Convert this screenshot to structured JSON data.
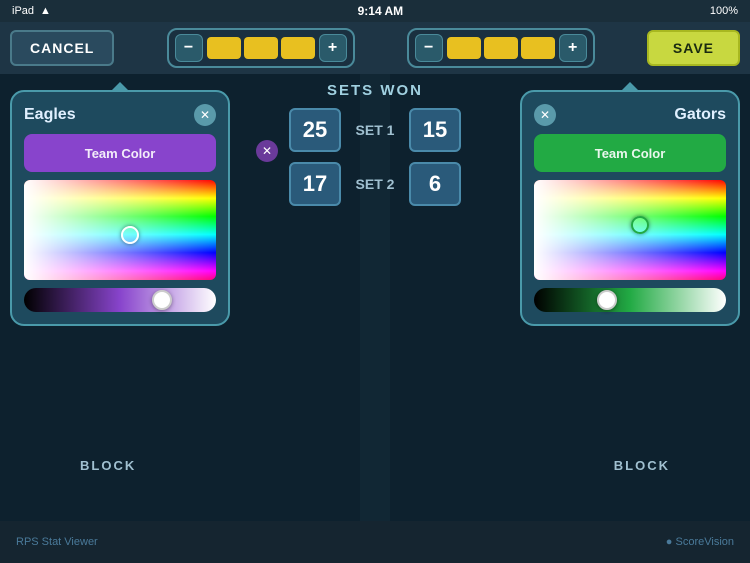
{
  "statusBar": {
    "carrier": "iPad",
    "wifi": "wifi",
    "time": "9:14 AM",
    "battery": "100%"
  },
  "toolbar": {
    "cancelLabel": "CANCEL",
    "saveLabel": "SAVE",
    "leftScoreControl": {
      "minus": "−",
      "plus": "+",
      "bars": [
        "#e8c020",
        "#e8c020",
        "#e8c020"
      ]
    },
    "rightScoreControl": {
      "minus": "−",
      "plus": "+",
      "bars": [
        "#e8c020",
        "#e8c020",
        "#e8c020"
      ]
    }
  },
  "setsWonHeader": "SETS WON",
  "sets": [
    {
      "label": "SET 1",
      "leftScore": "25",
      "rightScore": "15"
    },
    {
      "label": "SET 2",
      "leftScore": "17",
      "rightScore": "6"
    }
  ],
  "leftPanel": {
    "teamName": "Eagles",
    "teamColorLabel": "Team Color",
    "teamColor": "#8844cc",
    "cursorX": "55%",
    "cursorY": "55%",
    "hueThumbX": "72%"
  },
  "rightPanel": {
    "teamName": "Gators",
    "teamColorLabel": "Team Color",
    "teamColor": "#22aa44",
    "cursorX": "55%",
    "cursorY": "45%",
    "hueThumbX": "38%"
  },
  "blockLabels": {
    "left": "BLOCK",
    "right": "BLOCK"
  },
  "bottomBar": {
    "leftInfo": "RPS Stat Viewer",
    "rightInfo": "● ScoreVision"
  }
}
